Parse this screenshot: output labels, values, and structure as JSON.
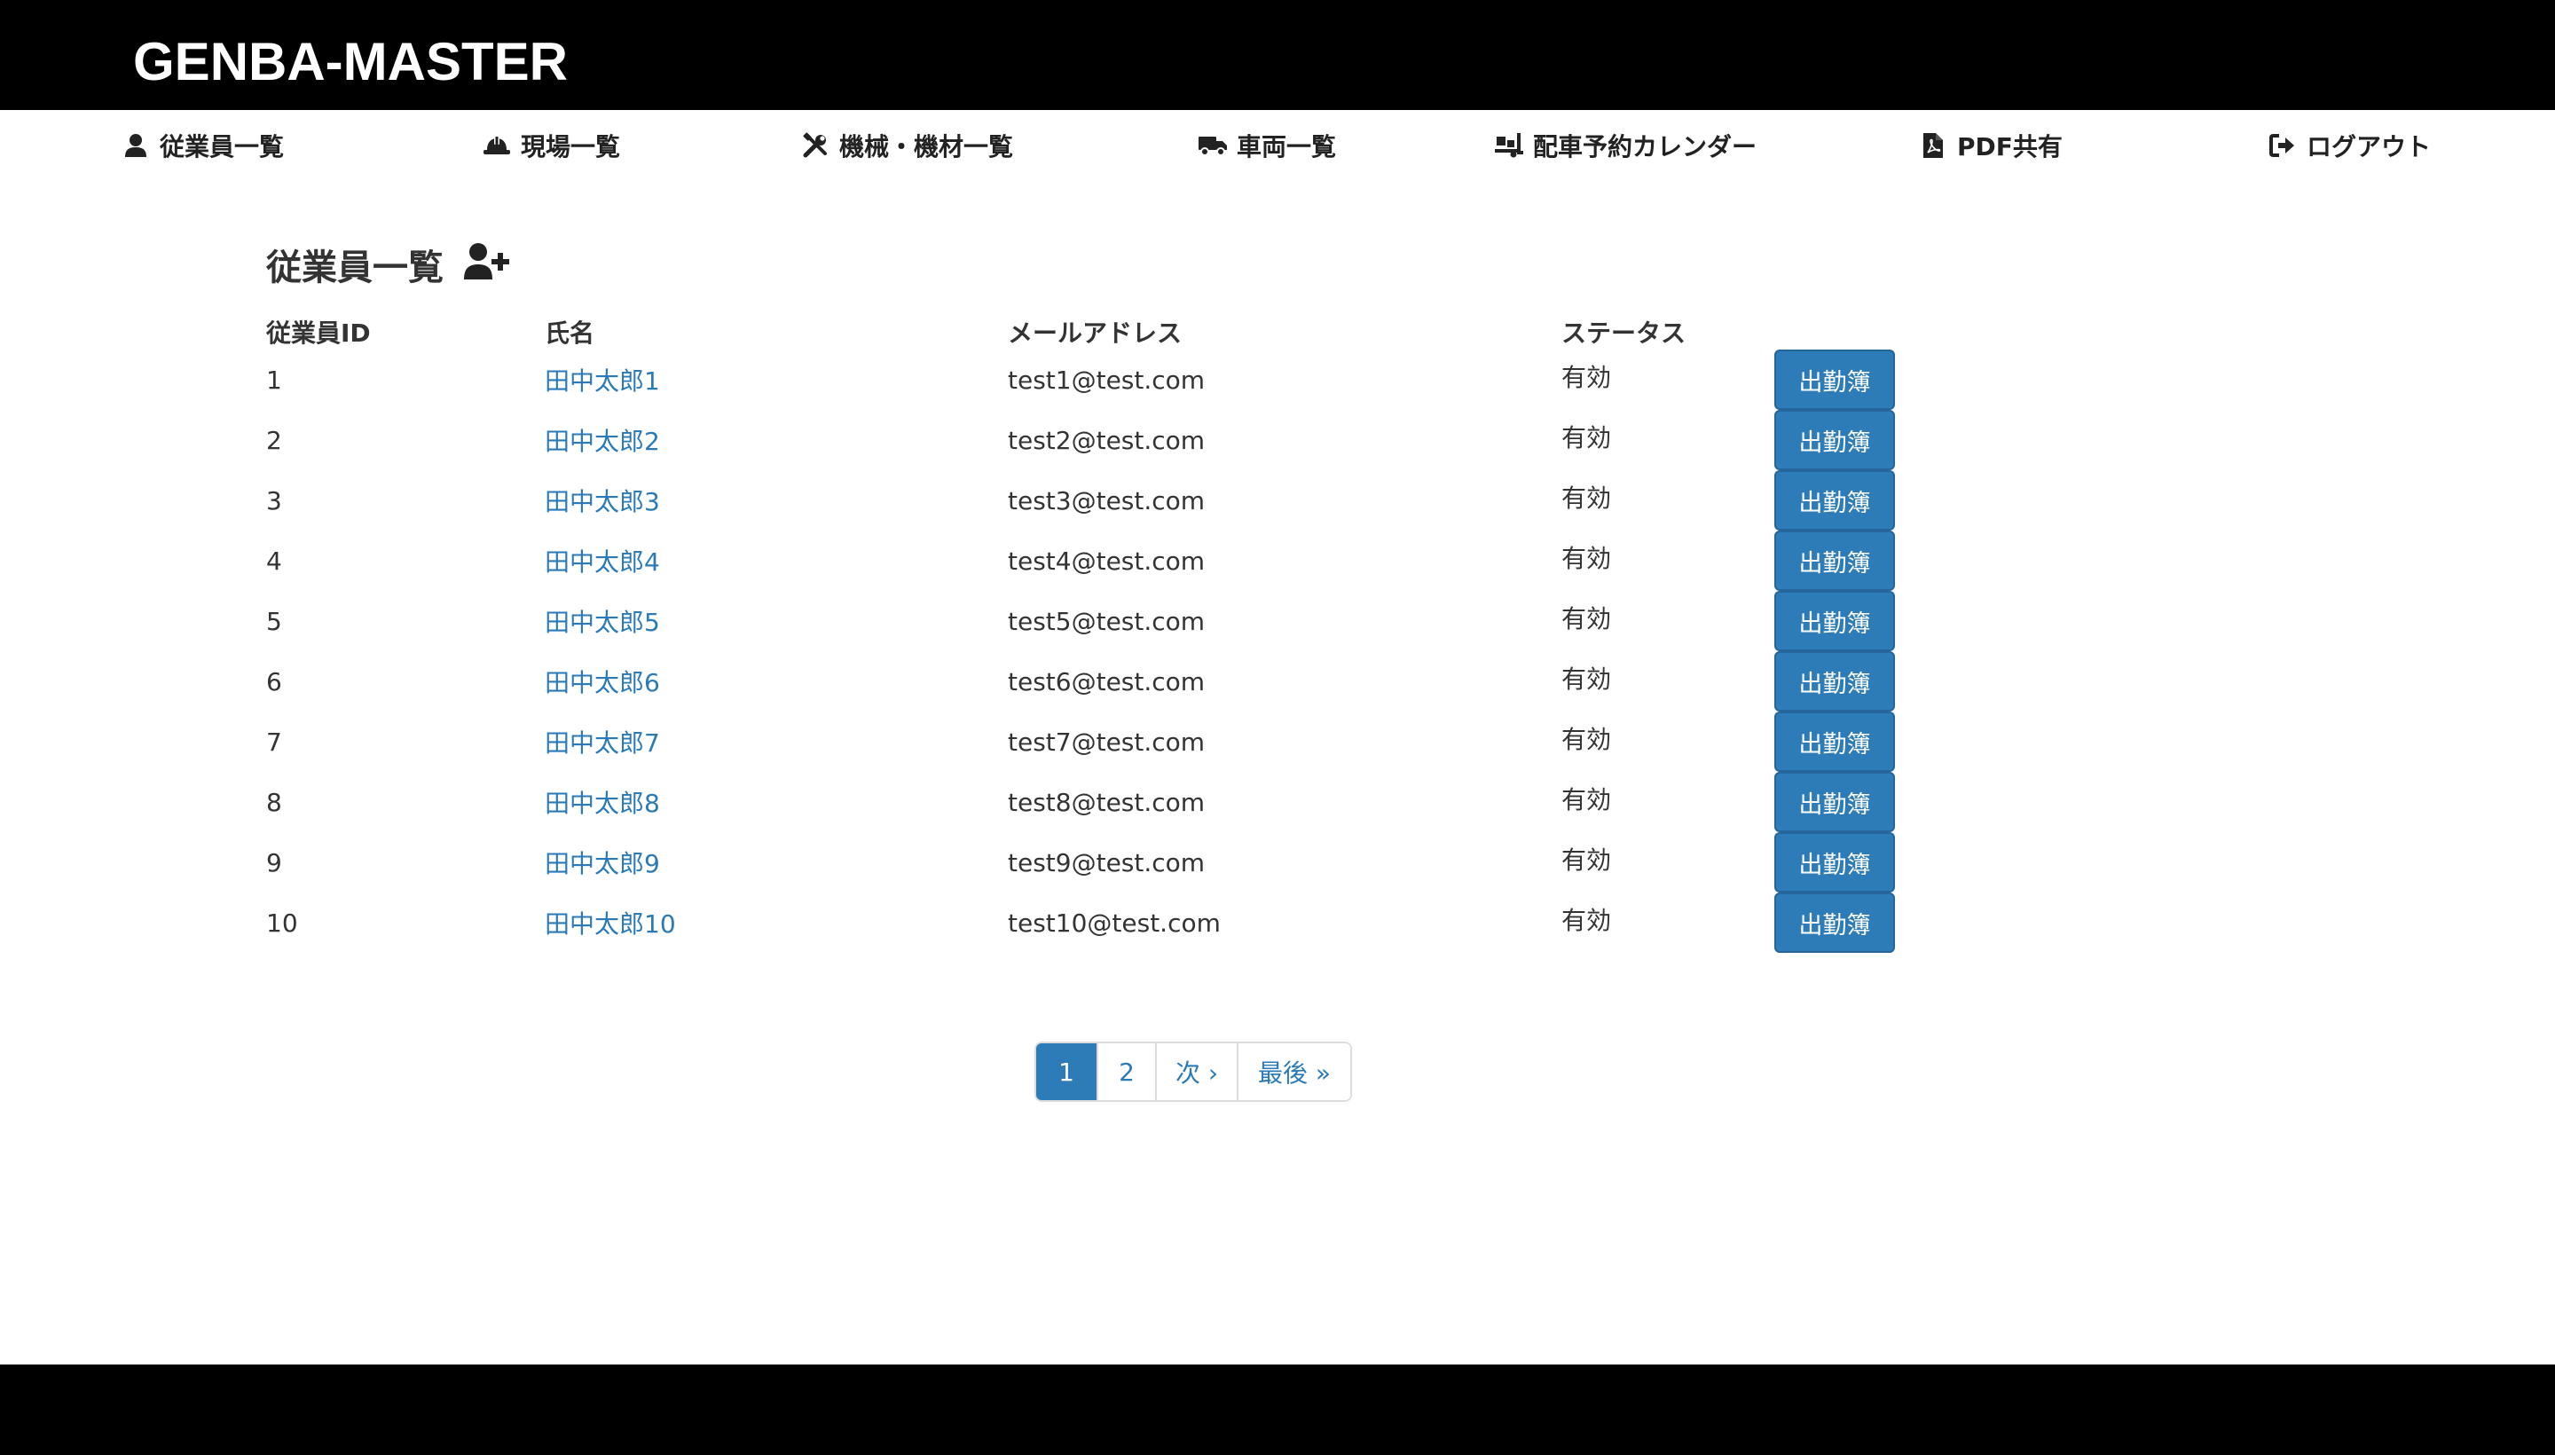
{
  "header": {
    "brand": "GENBA-MASTER"
  },
  "nav": {
    "items": [
      {
        "label": "従業員一覧",
        "icon": "user-icon"
      },
      {
        "label": "現場一覧",
        "icon": "hard-hat-icon"
      },
      {
        "label": "機械・機材一覧",
        "icon": "tools-icon"
      },
      {
        "label": "車両一覧",
        "icon": "truck-icon"
      },
      {
        "label": "配車予約カレンダー",
        "icon": "truck-loading-icon"
      },
      {
        "label": "PDF共有",
        "icon": "file-pdf-icon"
      },
      {
        "label": "ログアウト",
        "icon": "sign-out-icon"
      }
    ]
  },
  "main": {
    "title": "従業員一覧",
    "add_icon": "user-plus-icon",
    "table": {
      "headers": [
        "従業員ID",
        "氏名",
        "メールアドレス",
        "ステータス"
      ],
      "action_label": "出勤簿",
      "rows": [
        {
          "id": "1",
          "name": "田中太郎1",
          "email": "test1@test.com",
          "status": "有効"
        },
        {
          "id": "2",
          "name": "田中太郎2",
          "email": "test2@test.com",
          "status": "有効"
        },
        {
          "id": "3",
          "name": "田中太郎3",
          "email": "test3@test.com",
          "status": "有効"
        },
        {
          "id": "4",
          "name": "田中太郎4",
          "email": "test4@test.com",
          "status": "有効"
        },
        {
          "id": "5",
          "name": "田中太郎5",
          "email": "test5@test.com",
          "status": "有効"
        },
        {
          "id": "6",
          "name": "田中太郎6",
          "email": "test6@test.com",
          "status": "有効"
        },
        {
          "id": "7",
          "name": "田中太郎7",
          "email": "test7@test.com",
          "status": "有効"
        },
        {
          "id": "8",
          "name": "田中太郎8",
          "email": "test8@test.com",
          "status": "有効"
        },
        {
          "id": "9",
          "name": "田中太郎9",
          "email": "test9@test.com",
          "status": "有効"
        },
        {
          "id": "10",
          "name": "田中太郎10",
          "email": "test10@test.com",
          "status": "有効"
        }
      ]
    },
    "pagination": {
      "pages": [
        "1",
        "2"
      ],
      "current": "1",
      "next": "次 ›",
      "last": "最後 »"
    }
  },
  "colors": {
    "header_bg": "#000000",
    "accent": "#2d7cb7",
    "link": "#2a7ab8"
  }
}
